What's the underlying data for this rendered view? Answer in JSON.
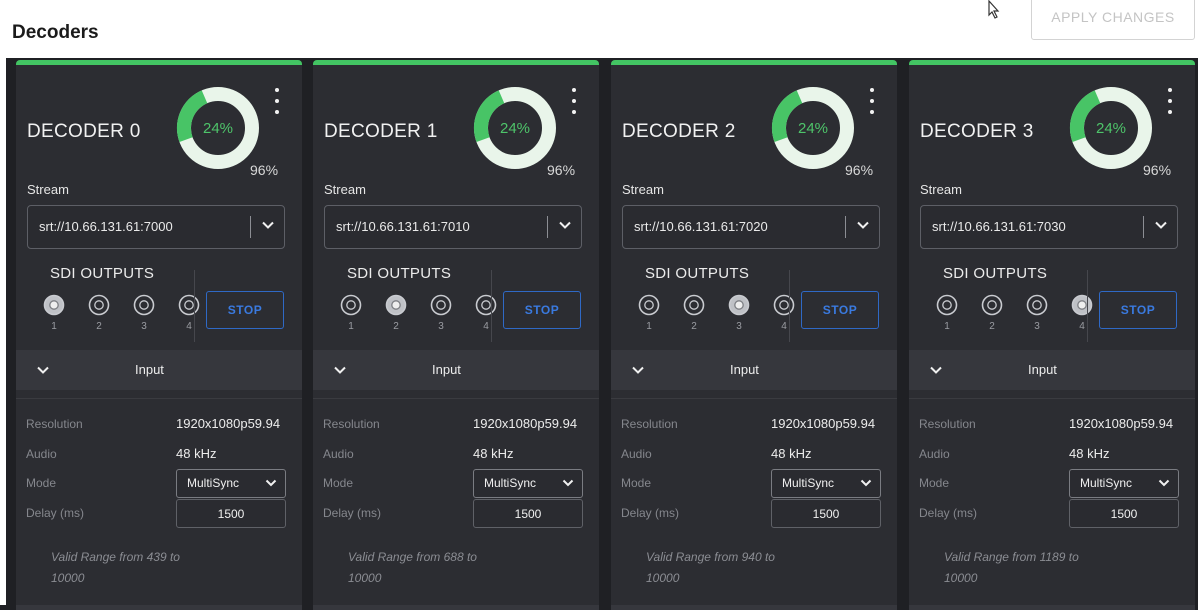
{
  "page_title": "Decoders",
  "apply_label": "APPLY CHANGES",
  "colors": {
    "accent_green": "#43c463",
    "donut_track": "#e9f5ea",
    "donut_fill": "#48c466",
    "stop_blue": "#2f69c6",
    "card_bg": "#2c2d32"
  },
  "icons": {
    "cursor": "pointer-cursor-icon",
    "menu": "kebab-menu-icon",
    "dropdown": "chevron-down-icon",
    "port": "sdi-port-icon"
  },
  "labels": {
    "stream": "Stream",
    "sdi_outputs": "SDI OUTPUTS",
    "stop": "STOP",
    "input": "Input",
    "resolution": "Resolution",
    "audio": "Audio",
    "mode": "Mode",
    "delay": "Delay (ms)"
  },
  "sdi_port_numbers": [
    "1",
    "2",
    "3",
    "4"
  ],
  "decoders": [
    {
      "title": "DECODER 0",
      "usage_inner": "24%",
      "usage_outer": "96%",
      "inner_fraction": 0.24,
      "stream": "srt://10.66.131.61:7000",
      "active_port": 1,
      "resolution": "1920x1080p59.94",
      "audio": "48 kHz",
      "mode": "MultiSync",
      "delay": "1500",
      "range_line1": "Valid Range from 439 to",
      "range_line2": "10000"
    },
    {
      "title": "DECODER 1",
      "usage_inner": "24%",
      "usage_outer": "96%",
      "inner_fraction": 0.24,
      "stream": "srt://10.66.131.61:7010",
      "active_port": 2,
      "resolution": "1920x1080p59.94",
      "audio": "48 kHz",
      "mode": "MultiSync",
      "delay": "1500",
      "range_line1": "Valid Range from 688 to",
      "range_line2": "10000"
    },
    {
      "title": "DECODER 2",
      "usage_inner": "24%",
      "usage_outer": "96%",
      "inner_fraction": 0.24,
      "stream": "srt://10.66.131.61:7020",
      "active_port": 3,
      "resolution": "1920x1080p59.94",
      "audio": "48 kHz",
      "mode": "MultiSync",
      "delay": "1500",
      "range_line1": "Valid Range from 940 to",
      "range_line2": "10000"
    },
    {
      "title": "DECODER 3",
      "usage_inner": "24%",
      "usage_outer": "96%",
      "inner_fraction": 0.24,
      "stream": "srt://10.66.131.61:7030",
      "active_port": 4,
      "resolution": "1920x1080p59.94",
      "audio": "48 kHz",
      "mode": "MultiSync",
      "delay": "1500",
      "range_line1": "Valid Range from 1189 to",
      "range_line2": "10000"
    }
  ]
}
